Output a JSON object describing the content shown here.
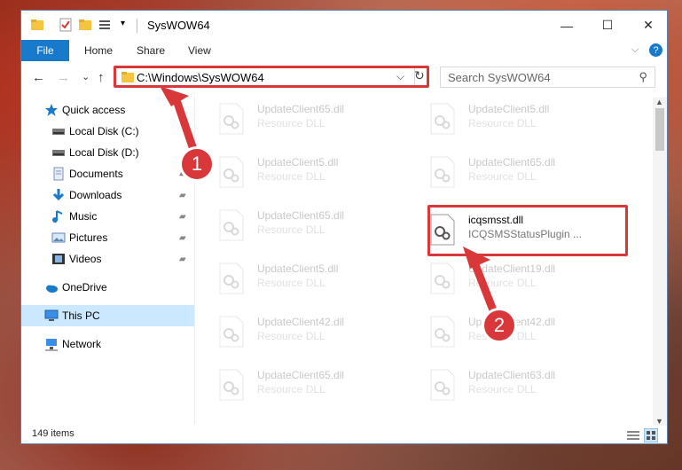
{
  "window": {
    "title": "SysWOW64",
    "controls": {
      "minimize": "—",
      "maximize": "☐",
      "close": "✕"
    }
  },
  "ribbon": {
    "tabs": [
      "File",
      "Home",
      "Share",
      "View"
    ],
    "expand_icon": "chevron-down-icon",
    "help_icon": "help-icon",
    "help_glyph": "?"
  },
  "address_bar": {
    "path": "C:\\Windows\\SysWOW64",
    "dropdown_glyph": "⌵",
    "refresh_glyph": "↻"
  },
  "nav_buttons": {
    "back": "←",
    "forward": "→",
    "recent": "⌄",
    "up": "↑"
  },
  "search": {
    "placeholder": "Search SysWOW64",
    "icon_glyph": "⚲"
  },
  "sidebar": {
    "items": [
      {
        "label": "Quick access",
        "icon": "star-icon",
        "pinned": false
      },
      {
        "label": "Local Disk (C:)",
        "icon": "drive-icon",
        "pinned": false
      },
      {
        "label": "Local Disk (D:)",
        "icon": "drive-icon",
        "pinned": false
      },
      {
        "label": "Documents",
        "icon": "documents-icon",
        "pinned": true
      },
      {
        "label": "Downloads",
        "icon": "download-icon",
        "pinned": true
      },
      {
        "label": "Music",
        "icon": "music-icon",
        "pinned": true
      },
      {
        "label": "Pictures",
        "icon": "pictures-icon",
        "pinned": true
      },
      {
        "label": "Videos",
        "icon": "videos-icon",
        "pinned": true
      },
      {
        "label": "OneDrive",
        "icon": "cloud-icon",
        "pinned": false
      },
      {
        "label": "This PC",
        "icon": "computer-icon",
        "pinned": false
      },
      {
        "label": "Network",
        "icon": "network-icon",
        "pinned": false
      }
    ],
    "pin_glyph": "📌"
  },
  "files": {
    "left": [
      {
        "name": "UpdateClient65.dll",
        "sub": "Resource DLL"
      },
      {
        "name": "UpdateClient5.dll",
        "sub": "Resource DLL"
      },
      {
        "name": "UpdateClient65.dll",
        "sub": "Resource DLL"
      },
      {
        "name": "UpdateClient5.dll",
        "sub": "Resource DLL"
      },
      {
        "name": "UpdateClient42.dll",
        "sub": "Resource DLL"
      },
      {
        "name": "UpdateClient65.dll",
        "sub": "Resource DLL"
      }
    ],
    "right": [
      {
        "name": "UpdateClient5.dll",
        "sub": "Resource DLL"
      },
      {
        "name": "UpdateClient65.dll",
        "sub": "Resource DLL"
      },
      {
        "name": "icqsmsst.dll",
        "sub": "ICQSMSStatusPlugin ..."
      },
      {
        "name": "UpdateClient19.dll",
        "sub": "Resource DLL"
      },
      {
        "name": "UpdateClient42.dll",
        "sub": "Resource DLL"
      },
      {
        "name": "UpdateClient63.dll",
        "sub": "Resource DLL"
      }
    ]
  },
  "status": {
    "count": "149 items"
  },
  "annotations": {
    "step1": "1",
    "step2": "2",
    "color": "#d9383a"
  }
}
